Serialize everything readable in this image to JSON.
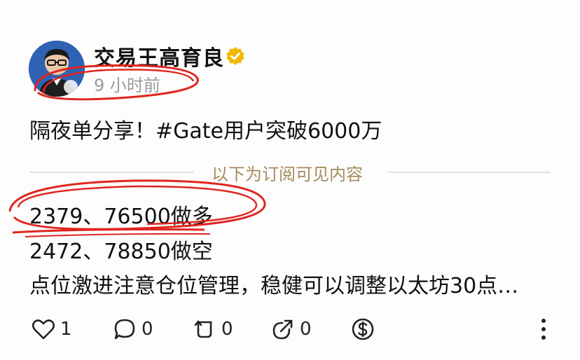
{
  "post": {
    "author": "交易王高育良",
    "time": "9 小时前",
    "text": "隔夜单分享！#Gate用户突破6000万",
    "divider_label": "以下为订阅可见内容",
    "line1": "2379、76500做多",
    "line2": "2472、78850做空",
    "line3": "点位激进注意仓位管理，稳健可以调整以太坊30点…"
  },
  "actions": {
    "like_count": "1",
    "comment_count": "0",
    "repost_count": "0",
    "share_count": "0"
  },
  "colors": {
    "annotation": "#e0251e",
    "verified": "#f0b90b",
    "divider_text": "#a68b5b"
  },
  "icons": [
    "avatar",
    "verified-badge-icon",
    "heart-icon",
    "comment-icon",
    "repost-icon",
    "share-icon",
    "tip-dollar-icon",
    "more-vertical-icon"
  ]
}
